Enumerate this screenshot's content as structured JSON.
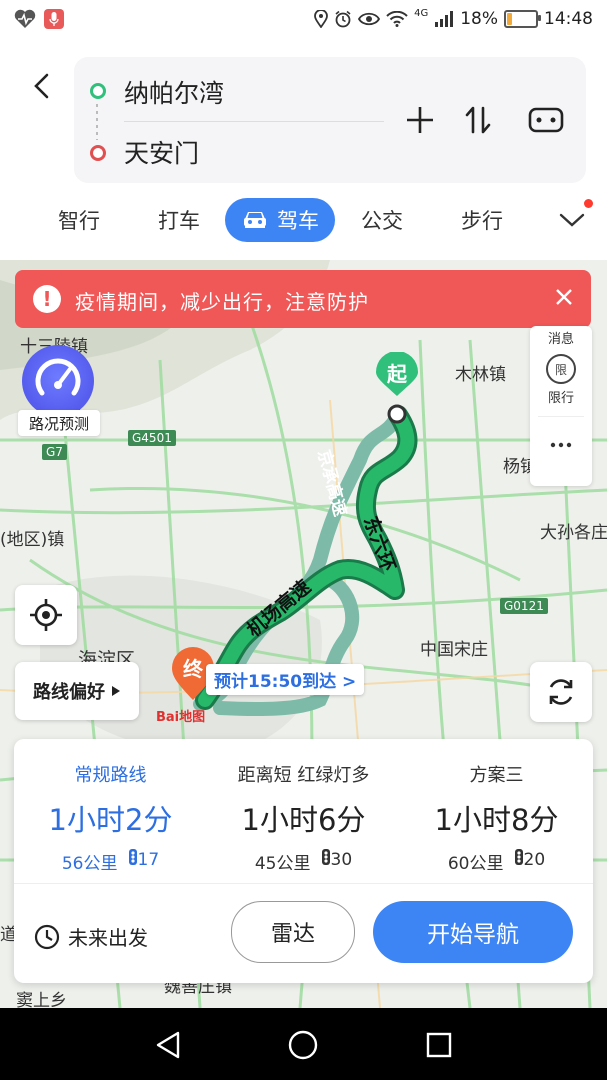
{
  "status_bar": {
    "time": "14:48",
    "battery": "18%",
    "network": "4G",
    "battery_level": 0.18
  },
  "route": {
    "origin": "纳帕尔湾",
    "destination": "天安门"
  },
  "tabs": [
    {
      "label": "智行"
    },
    {
      "label": "打车"
    },
    {
      "label": "驾车"
    },
    {
      "label": "公交"
    },
    {
      "label": "步行"
    }
  ],
  "alert": {
    "text": "疫情期间，减少出行，注意防护"
  },
  "side_panel": {
    "top_label": "消息",
    "limit_label": "限行",
    "limit_icon_text": "限"
  },
  "traffic_prediction": "路况预测",
  "route_pref": "路线偏好",
  "map": {
    "labels": {
      "l1": "十三陵镇",
      "l2": "木林镇",
      "l3": "杨镇",
      "l4": "(地区)镇",
      "l5": "大孙各庄",
      "l6": "中国宋庄",
      "l7": "海淀区",
      "l8": "京承高速",
      "l9": "东六环",
      "l10": "机场高速",
      "l11": "窦上乡",
      "l12": "魏善庄镇",
      "l13": "道",
      "l14": "区"
    },
    "shields": {
      "s1": "G4501",
      "s2": "G7",
      "s3": "G0121"
    },
    "start_pin": "起",
    "end_pin": "终",
    "eta": "预计15:50到达 >",
    "logo": "Bai地图"
  },
  "routes": [
    {
      "name": "常规路线",
      "duration": "1小时2分",
      "distance": "56公里",
      "lights": "17",
      "selected": true
    },
    {
      "name": "距离短  红绿灯多",
      "duration": "1小时6分",
      "distance": "45公里",
      "lights": "30",
      "selected": false
    },
    {
      "name": "方案三",
      "duration": "1小时8分",
      "distance": "60公里",
      "lights": "20",
      "selected": false
    }
  ],
  "actions": {
    "future_departure": "未来出发",
    "radar": "雷达",
    "start_navigation": "开始导航"
  },
  "colors": {
    "accent": "#3d85f5",
    "alert": "#f05757",
    "route_green": "#27b86a",
    "start_green": "#30c07c",
    "end_orange": "#f06a35"
  }
}
